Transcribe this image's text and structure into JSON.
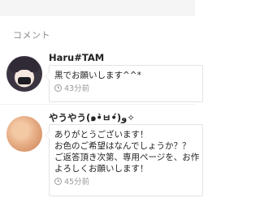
{
  "section": {
    "title": "コメント"
  },
  "comments": [
    {
      "username": "Haru#TAM",
      "avatar_icon": "user-avatar",
      "message_lines": [
        "黒でお願いします^^*"
      ],
      "time": "43分前"
    },
    {
      "username": "やうやう(๑•̀ㅂ•́)و✧",
      "avatar_icon": "user-avatar",
      "message_lines": [
        "ありがとうございます！",
        "お色のご希望はなんでしょうか？？",
        "ご返答頂き次第、専用ページを、お作",
        "よろしくお願いします！"
      ],
      "time": "45分前"
    }
  ],
  "colors": {
    "text": "#222222",
    "muted": "#9a9a9a",
    "border": "#e3e3e3"
  }
}
